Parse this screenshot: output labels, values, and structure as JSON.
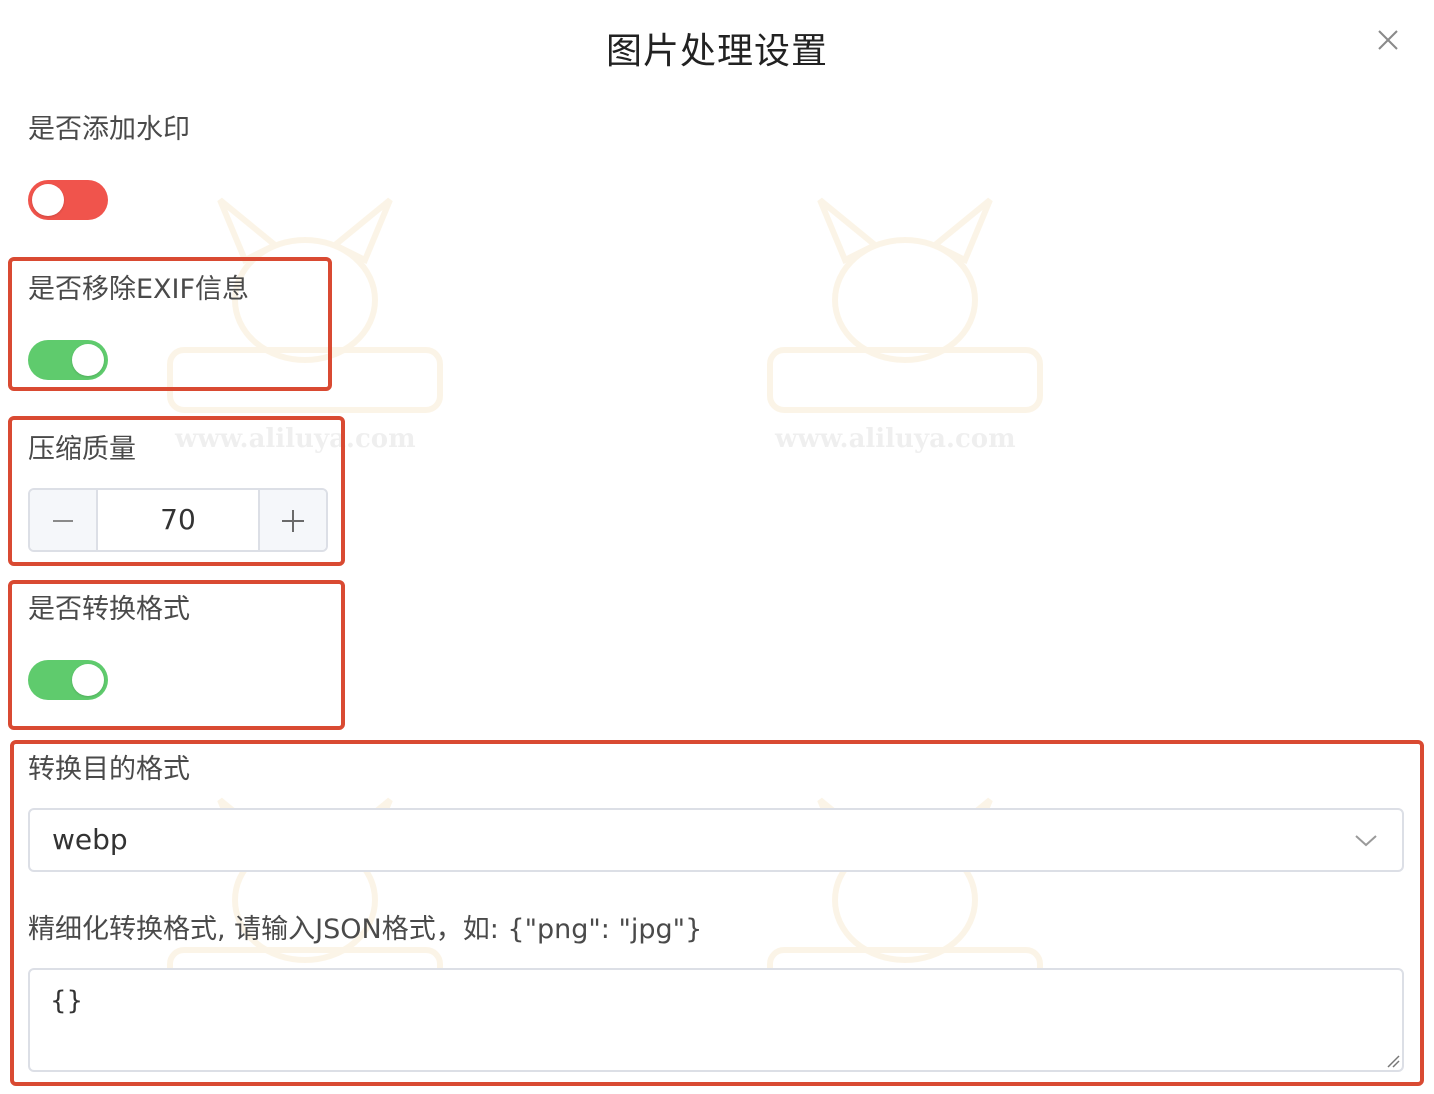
{
  "dialog": {
    "title": "图片处理设置"
  },
  "watermark": {
    "icon": "fox-mascot-logo",
    "text": "www.aliluya.com"
  },
  "fields": {
    "watermark": {
      "label": "是否添加水印",
      "enabled": false
    },
    "remove_exif": {
      "label": "是否移除EXIF信息",
      "enabled": true
    },
    "quality": {
      "label": "压缩质量",
      "value": "70",
      "decrement_icon": "minus-icon",
      "increment_icon": "plus-icon"
    },
    "convert_format": {
      "label": "是否转换格式",
      "enabled": true
    },
    "target_format": {
      "label": "转换目的格式",
      "selected": "webp"
    },
    "fine_grained": {
      "label": "精细化转换格式, 请输入JSON格式，如: {\"png\": \"jpg\"}",
      "value": "{}"
    }
  },
  "colors": {
    "switch_off": "#f0544c",
    "switch_on": "#5fcb6d",
    "highlight": "#d94a32",
    "border": "#dcdfe6"
  }
}
